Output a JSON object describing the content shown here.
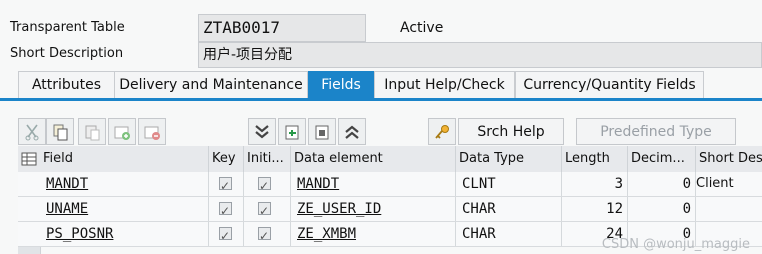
{
  "header": {
    "type_label": "Transparent Table",
    "table_name": "ZTAB0017",
    "status": "Active",
    "short_desc_label": "Short Description",
    "short_desc_value": "用户-项目分配"
  },
  "tabs": [
    {
      "label": "Attributes",
      "active": false
    },
    {
      "label": "Delivery and Maintenance",
      "active": false
    },
    {
      "label": "Fields",
      "active": true
    },
    {
      "label": "Input Help/Check",
      "active": false
    },
    {
      "label": "Currency/Quantity Fields",
      "active": false
    }
  ],
  "toolbar": {
    "icons": [
      "cut-icon",
      "copy-icon",
      "paste-icon",
      "insert-row-icon",
      "delete-row-icon",
      "expand-icon",
      "first-page-icon",
      "last-page-icon",
      "collapse-icon",
      "key-icon"
    ],
    "srch_help_label": "Srch Help",
    "predefined_type_label": "Predefined Type"
  },
  "grid": {
    "columns": [
      "Field",
      "Key",
      "Initi...",
      "Data element",
      "Data Type",
      "Length",
      "Decim...",
      "Short Des"
    ],
    "rows": [
      {
        "field": "MANDT",
        "key": true,
        "init": true,
        "data_element": "MANDT",
        "data_type": "CLNT",
        "length": "3",
        "decimals": "0",
        "short_desc": "Client"
      },
      {
        "field": "UNAME",
        "key": true,
        "init": true,
        "data_element": "ZE_USER_ID",
        "data_type": "CHAR",
        "length": "12",
        "decimals": "0",
        "short_desc": ""
      },
      {
        "field": "PS_POSNR",
        "key": true,
        "init": true,
        "data_element": "ZE_XMBM",
        "data_type": "CHAR",
        "length": "24",
        "decimals": "0",
        "short_desc": ""
      }
    ]
  },
  "watermark": "CSDN @wonju_maggie",
  "colors": {
    "accent": "#1b84c9"
  }
}
